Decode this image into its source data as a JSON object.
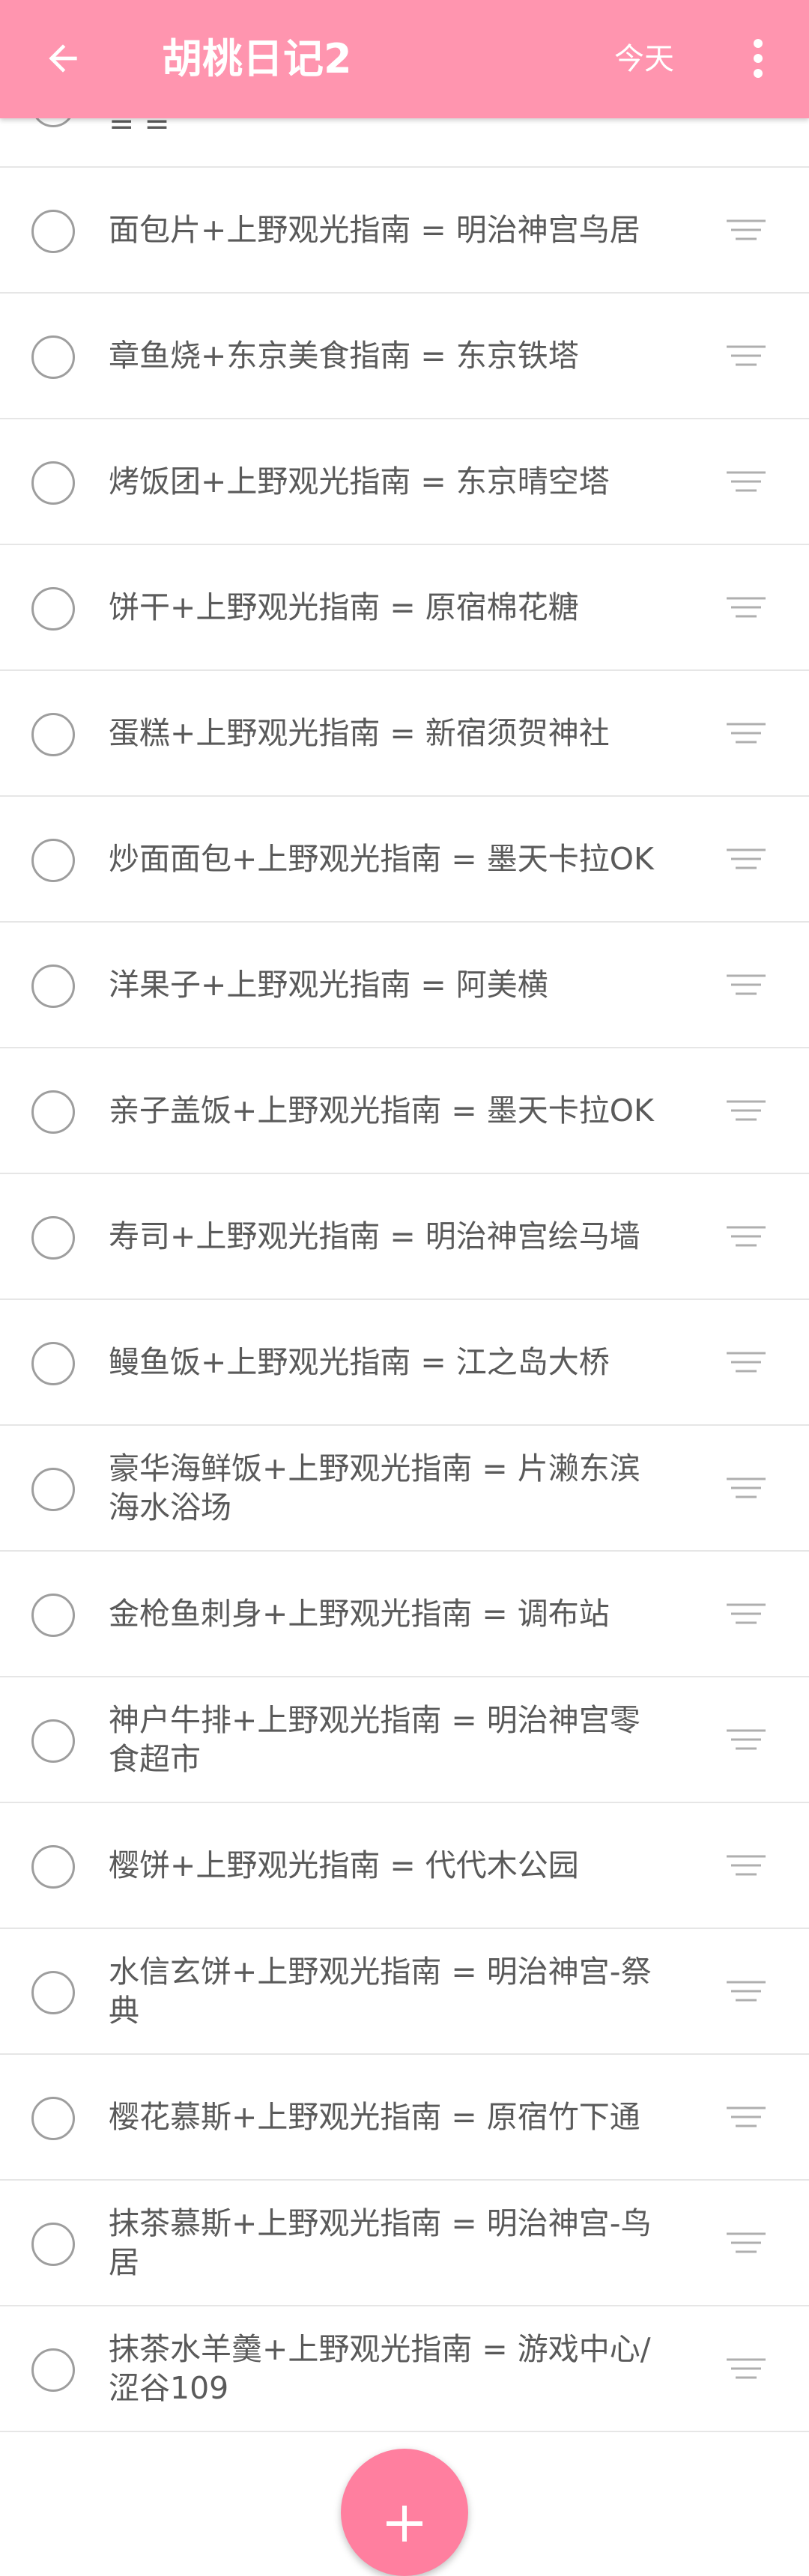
{
  "app_bar": {
    "title": "胡桃日记2",
    "today_label": "今天",
    "background": "#FF95AF",
    "back_icon": "arrow-left-icon",
    "more_icon": "more-vert-icon"
  },
  "items": [
    {
      "text": "= = = = = = = = = = = = = = = = = ="
    },
    {
      "text": "面包片+上野观光指南 = 明治神宫鸟居"
    },
    {
      "text": "章鱼烧+东京美食指南 = 东京铁塔"
    },
    {
      "text": "烤饭团+上野观光指南 = 东京晴空塔"
    },
    {
      "text": "饼干+上野观光指南 = 原宿棉花糖"
    },
    {
      "text": "蛋糕+上野观光指南 = 新宿须贺神社"
    },
    {
      "text": "炒面面包+上野观光指南 = 墨天卡拉OK"
    },
    {
      "text": "洋果子+上野观光指南 = 阿美横"
    },
    {
      "text": "亲子盖饭+上野观光指南 = 墨天卡拉OK"
    },
    {
      "text": "寿司+上野观光指南 = 明治神宫绘马墙"
    },
    {
      "text": "鳗鱼饭+上野观光指南 = 江之岛大桥"
    },
    {
      "text": "豪华海鲜饭+上野观光指南 = 片濑东滨海水浴场",
      "line1": "豪华海鲜饭+上野观光指南 = 片濑东滨",
      "line2": "海水浴场"
    },
    {
      "text": "金枪鱼刺身+上野观光指南 = 调布站"
    },
    {
      "text": "神户牛排+上野观光指南 = 明治神宫零食超市",
      "line1": "神户牛排+上野观光指南 = 明治神宫零",
      "line2": "食超市"
    },
    {
      "text": "樱饼+上野观光指南 = 代代木公园"
    },
    {
      "text": "水信玄饼+上野观光指南 = 明治神宫-祭典",
      "line1": "水信玄饼+上野观光指南 = 明治神宫-祭",
      "line2": "典"
    },
    {
      "text": "樱花慕斯+上野观光指南 = 原宿竹下通"
    },
    {
      "text": "抹茶慕斯+上野观光指南 = 明治神宫-鸟居",
      "line1": "抹茶慕斯+上野观光指南 = 明治神宫-鸟",
      "line2": "居"
    },
    {
      "text": "抹茶水羊羹+上野观光指南 = 游戏中心/涩谷109",
      "line1": "抹茶水羊羹+上野观光指南 = 游戏中心/",
      "line2": "涩谷109"
    }
  ],
  "fab": {
    "icon": "plus-icon",
    "color": "#FF7F9F"
  }
}
